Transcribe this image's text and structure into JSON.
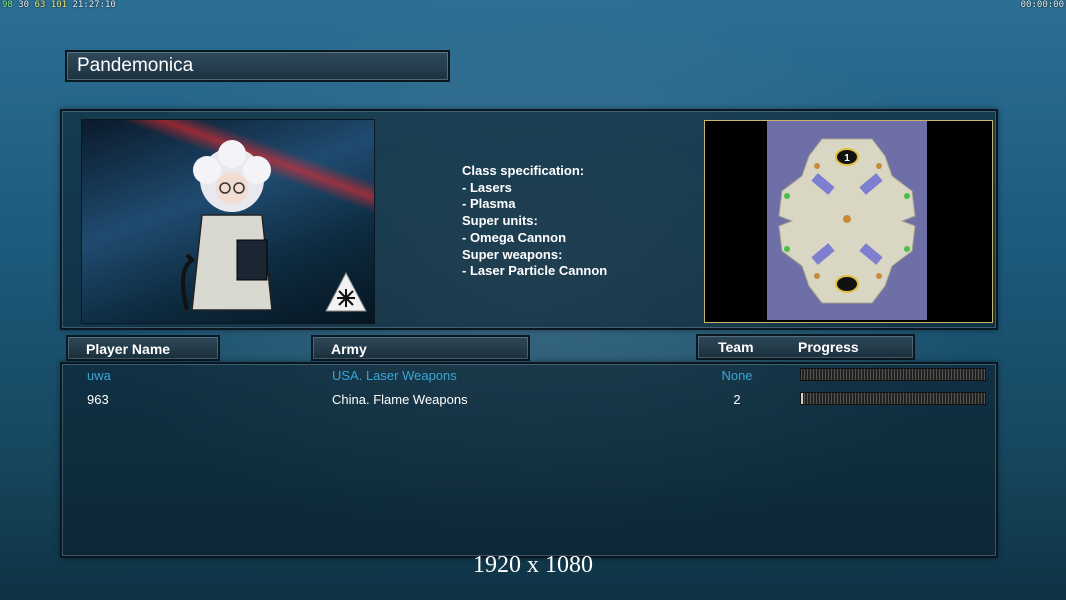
{
  "overlay": {
    "left_parts": [
      "98",
      "30",
      "63",
      "101"
    ],
    "clock": "21:27:10",
    "right": "00:00:00"
  },
  "title": "Pandemonica",
  "class_info": {
    "lines": [
      "Class specification:",
      "- Lasers",
      "- Plasma",
      "Super units:",
      "- Omega Cannon",
      "Super weapons:",
      "- Laser Particle Cannon"
    ]
  },
  "minimap": {
    "start_positions": [
      "1"
    ]
  },
  "table": {
    "headers": {
      "player": "Player Name",
      "army": "Army",
      "team": "Team",
      "progress": "Progress"
    },
    "rows": [
      {
        "name": "uwa",
        "army": "USA. Laser Weapons",
        "team": "None",
        "progress": 0.0,
        "local": true
      },
      {
        "name": "963",
        "army": "China. Flame Weapons",
        "team": "2",
        "progress": 0.01,
        "local": false
      }
    ]
  },
  "resolution": "1920 x 1080",
  "colors": {
    "local_player": "#39a6d8",
    "minimap_frame": "#c9b46a"
  }
}
